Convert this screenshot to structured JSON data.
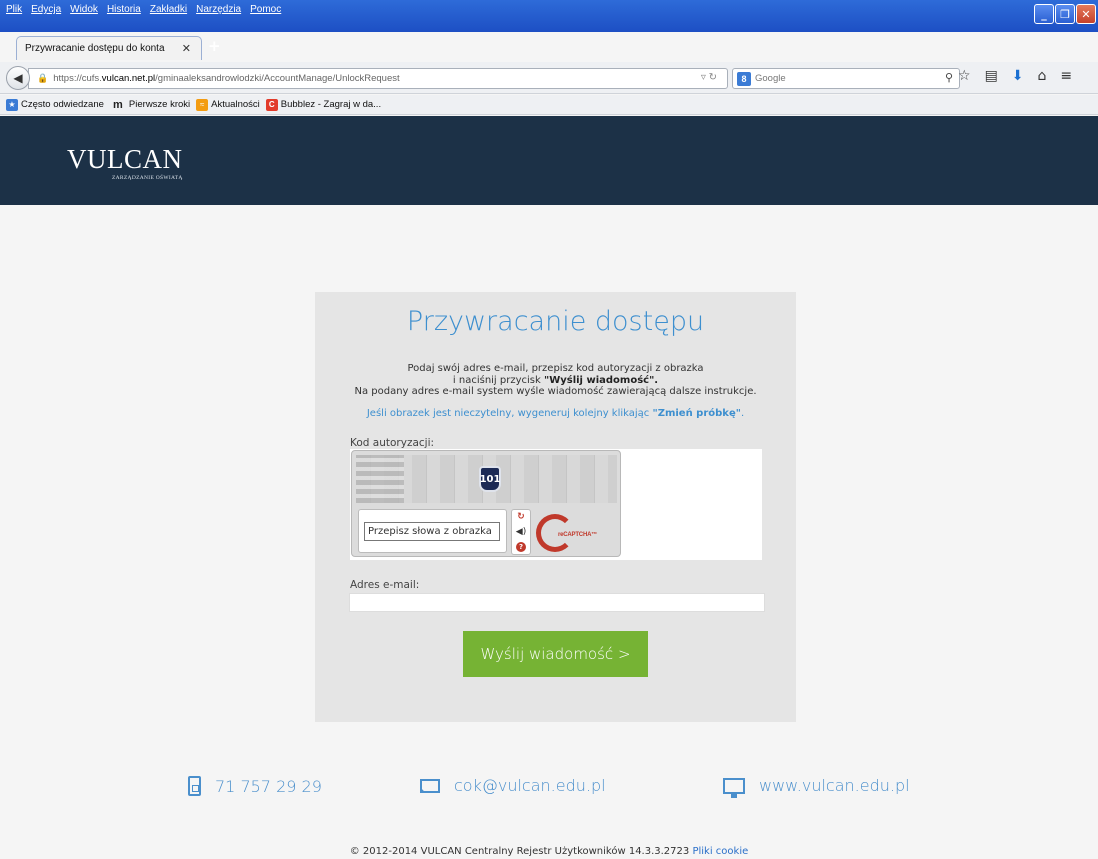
{
  "browser": {
    "menu": [
      "Plik",
      "Edycja",
      "Widok",
      "Historia",
      "Zakładki",
      "Narzędzia",
      "Pomoc"
    ],
    "tab_title": "Przywracanie dostępu do konta",
    "url_prefix": "https://cufs.",
    "url_host": "vulcan.net.pl",
    "url_path": "/gminaaleksandrowlodzki/AccountManage/UnlockRequest",
    "search_placeholder": "Google",
    "bookmarks": [
      "Często odwiedzane",
      "Pierwsze kroki",
      "Aktualności",
      "Bubblez - Zagraj w da..."
    ]
  },
  "header": {
    "logo_main": "VULCAN",
    "logo_sub": "ZARZĄDZANIE OŚWIATĄ"
  },
  "form": {
    "title": "Przywracanie dostępu",
    "instr_line1": "Podaj swój adres e-mail, przepisz kod autoryzacji z obrazka",
    "instr_line2_pre": "i naciśnij przycisk ",
    "instr_line2_bold": "\"Wyślij wiadomość\".",
    "instr_line3": "Na podany adres e-mail system wyśle wiadomość zawierającą dalsze instrukcje.",
    "hint_pre": "Jeśli obrazek jest nieczytelny, wygeneruj kolejny klikając ",
    "hint_bold": "\"Zmień próbkę\"",
    "hint_post": ".",
    "code_label": "Kod autoryzacji:",
    "captcha_sign": "101",
    "captcha_placeholder": "Przepisz słowa z obrazka",
    "recaptcha_text": "reCAPTCHA",
    "recaptcha_tm": "™",
    "email_label": "Adres e-mail:",
    "email_value": "",
    "submit_label": "Wyślij wiadomość >"
  },
  "contacts": {
    "phone": "71 757 29 29",
    "email": "cok@vulcan.edu.pl",
    "website": "www.vulcan.edu.pl"
  },
  "footer": {
    "copyright": "© 2012-2014 VULCAN Centralny Rejestr Użytkowników 14.3.3.2723",
    "cookie_link": "Pliki cookie"
  }
}
